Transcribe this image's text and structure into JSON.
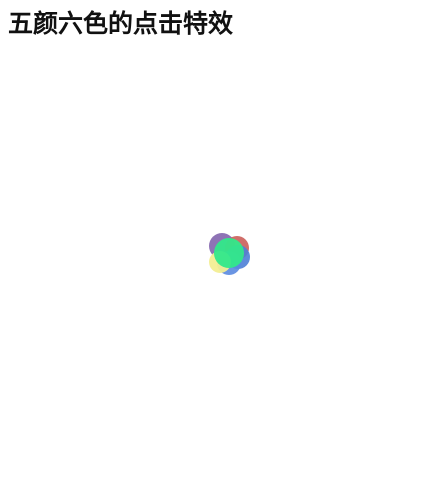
{
  "page": {
    "title": "五颜六色的点击特效"
  },
  "click_effect": {
    "particles": [
      {
        "name": "particle-purple",
        "color": "#7a5aa8"
      },
      {
        "name": "particle-red",
        "color": "#c8554f"
      },
      {
        "name": "particle-blue-1",
        "color": "#4e7fd6"
      },
      {
        "name": "particle-blue-2",
        "color": "#5a8ae0"
      },
      {
        "name": "particle-yellow",
        "color": "#f3ee93"
      },
      {
        "name": "particle-green",
        "color": "#33e88a"
      }
    ]
  }
}
